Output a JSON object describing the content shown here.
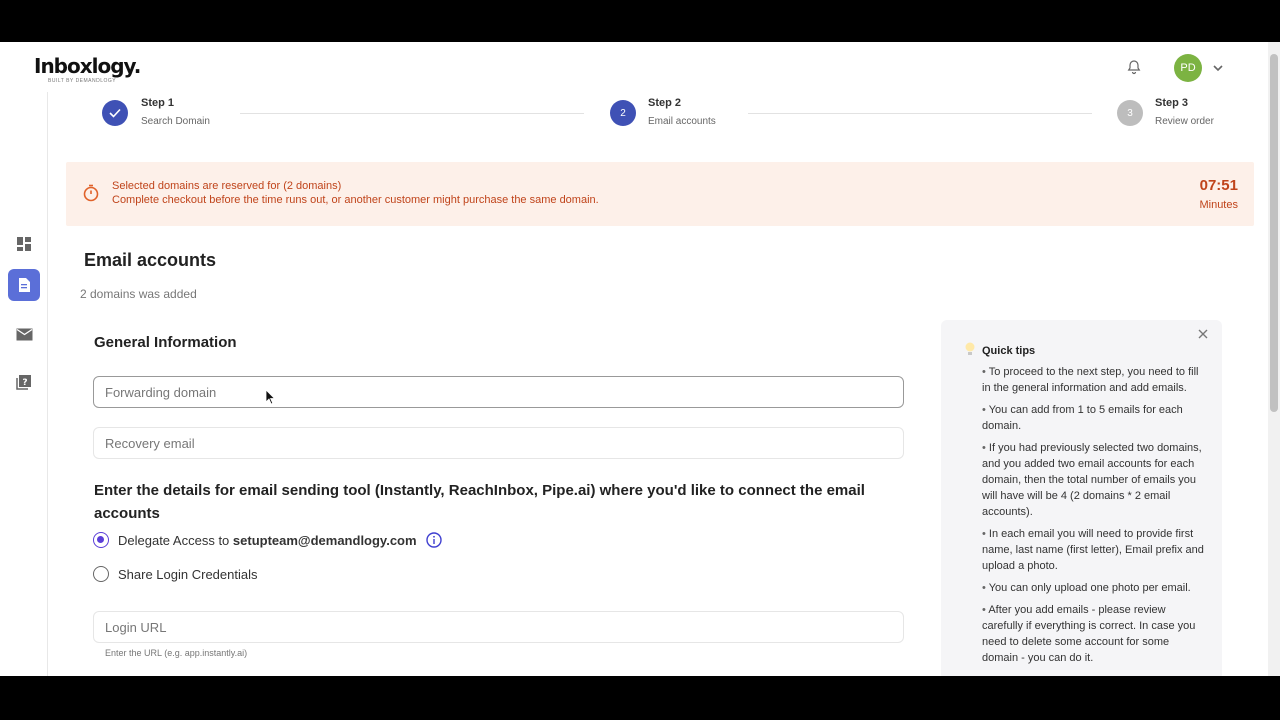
{
  "brand": {
    "name": "Inboxlogy.",
    "tagline": "BUILT BY DEMANDLOGY"
  },
  "header": {
    "user_initials": "PD"
  },
  "steps": [
    {
      "title": "Step 1",
      "subtitle": "Search Domain",
      "state": "done",
      "number": "1"
    },
    {
      "title": "Step 2",
      "subtitle": "Email accounts",
      "state": "active",
      "number": "2"
    },
    {
      "title": "Step 3",
      "subtitle": "Review order",
      "state": "pending",
      "number": "3"
    }
  ],
  "alert": {
    "line1": "Selected domains are reserved for (2 domains)",
    "line2": "Complete checkout before the time runs out, or another customer might purchase the same domain.",
    "timer": "07:51",
    "timer_unit": "Minutes"
  },
  "page": {
    "title": "Email accounts",
    "subtitle": "2 domains was added"
  },
  "general": {
    "title": "General Information",
    "forwarding_placeholder": "Forwarding domain",
    "recovery_placeholder": "Recovery email"
  },
  "tool": {
    "title": "Enter the details for email sending tool (Instantly, ReachInbox, Pipe.ai) where you'd like to connect the email accounts",
    "delegate_label": "Delegate Access to ",
    "delegate_email": "setupteam@demandlogy.com",
    "share_label": "Share Login Credentials",
    "login_placeholder": "Login URL",
    "login_hint": "Enter the URL (e.g. app.instantly.ai)"
  },
  "tips": {
    "title": "Quick tips",
    "items": [
      "To proceed to the next step, you need to fill in the general information and add emails.",
      "You can add from 1 to 5 emails for each domain.",
      "If you had previously selected two domains, and you added two email accounts for each domain, then the total number of emails you will have will be 4 (2 domains * 2 email accounts).",
      "In each email you will need to provide first name, last name (first letter), Email prefix and upload a photo.",
      "You can only upload one photo per email.",
      "After you add emails - please review carefully if everything is correct. In case you need to delete some account for some domain - you can do it."
    ]
  },
  "colors": {
    "accent": "#5b6fd8",
    "radio_accent": "#5b3fd8",
    "alert_bg": "#fdf0e9",
    "alert_text": "#c0441b",
    "avatar_bg": "#7cb342"
  }
}
